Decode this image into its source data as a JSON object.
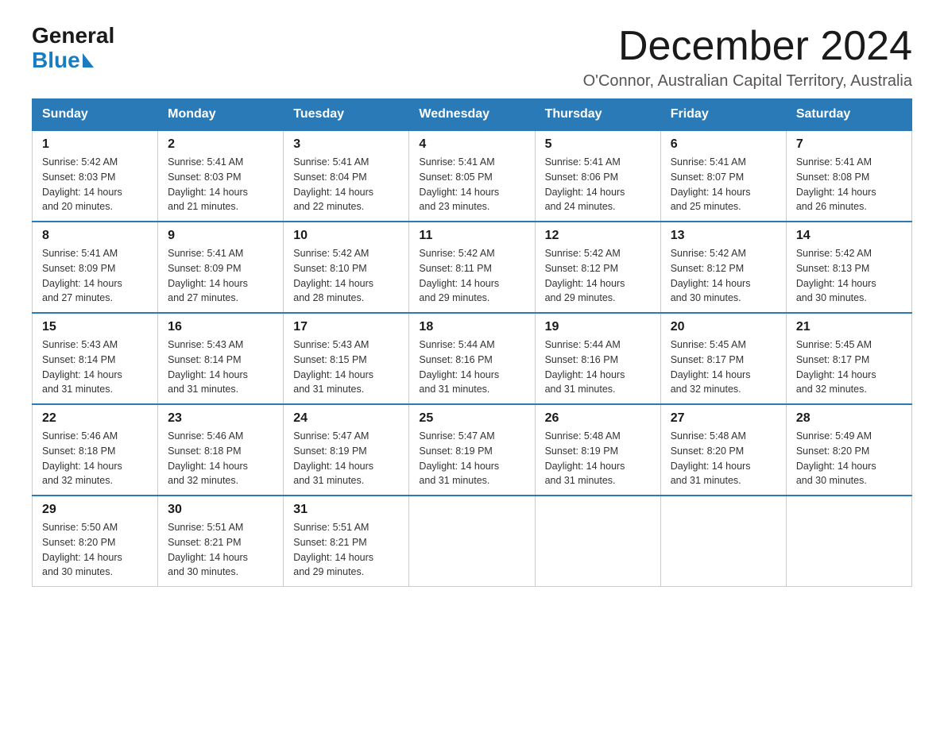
{
  "header": {
    "logo": {
      "general": "General",
      "blue": "Blue"
    },
    "title": "December 2024",
    "location": "O'Connor, Australian Capital Territory, Australia"
  },
  "calendar": {
    "days_of_week": [
      "Sunday",
      "Monday",
      "Tuesday",
      "Wednesday",
      "Thursday",
      "Friday",
      "Saturday"
    ],
    "weeks": [
      [
        {
          "day": "1",
          "sunrise": "5:42 AM",
          "sunset": "8:03 PM",
          "daylight": "14 hours and 20 minutes."
        },
        {
          "day": "2",
          "sunrise": "5:41 AM",
          "sunset": "8:03 PM",
          "daylight": "14 hours and 21 minutes."
        },
        {
          "day": "3",
          "sunrise": "5:41 AM",
          "sunset": "8:04 PM",
          "daylight": "14 hours and 22 minutes."
        },
        {
          "day": "4",
          "sunrise": "5:41 AM",
          "sunset": "8:05 PM",
          "daylight": "14 hours and 23 minutes."
        },
        {
          "day": "5",
          "sunrise": "5:41 AM",
          "sunset": "8:06 PM",
          "daylight": "14 hours and 24 minutes."
        },
        {
          "day": "6",
          "sunrise": "5:41 AM",
          "sunset": "8:07 PM",
          "daylight": "14 hours and 25 minutes."
        },
        {
          "day": "7",
          "sunrise": "5:41 AM",
          "sunset": "8:08 PM",
          "daylight": "14 hours and 26 minutes."
        }
      ],
      [
        {
          "day": "8",
          "sunrise": "5:41 AM",
          "sunset": "8:09 PM",
          "daylight": "14 hours and 27 minutes."
        },
        {
          "day": "9",
          "sunrise": "5:41 AM",
          "sunset": "8:09 PM",
          "daylight": "14 hours and 27 minutes."
        },
        {
          "day": "10",
          "sunrise": "5:42 AM",
          "sunset": "8:10 PM",
          "daylight": "14 hours and 28 minutes."
        },
        {
          "day": "11",
          "sunrise": "5:42 AM",
          "sunset": "8:11 PM",
          "daylight": "14 hours and 29 minutes."
        },
        {
          "day": "12",
          "sunrise": "5:42 AM",
          "sunset": "8:12 PM",
          "daylight": "14 hours and 29 minutes."
        },
        {
          "day": "13",
          "sunrise": "5:42 AM",
          "sunset": "8:12 PM",
          "daylight": "14 hours and 30 minutes."
        },
        {
          "day": "14",
          "sunrise": "5:42 AM",
          "sunset": "8:13 PM",
          "daylight": "14 hours and 30 minutes."
        }
      ],
      [
        {
          "day": "15",
          "sunrise": "5:43 AM",
          "sunset": "8:14 PM",
          "daylight": "14 hours and 31 minutes."
        },
        {
          "day": "16",
          "sunrise": "5:43 AM",
          "sunset": "8:14 PM",
          "daylight": "14 hours and 31 minutes."
        },
        {
          "day": "17",
          "sunrise": "5:43 AM",
          "sunset": "8:15 PM",
          "daylight": "14 hours and 31 minutes."
        },
        {
          "day": "18",
          "sunrise": "5:44 AM",
          "sunset": "8:16 PM",
          "daylight": "14 hours and 31 minutes."
        },
        {
          "day": "19",
          "sunrise": "5:44 AM",
          "sunset": "8:16 PM",
          "daylight": "14 hours and 31 minutes."
        },
        {
          "day": "20",
          "sunrise": "5:45 AM",
          "sunset": "8:17 PM",
          "daylight": "14 hours and 32 minutes."
        },
        {
          "day": "21",
          "sunrise": "5:45 AM",
          "sunset": "8:17 PM",
          "daylight": "14 hours and 32 minutes."
        }
      ],
      [
        {
          "day": "22",
          "sunrise": "5:46 AM",
          "sunset": "8:18 PM",
          "daylight": "14 hours and 32 minutes."
        },
        {
          "day": "23",
          "sunrise": "5:46 AM",
          "sunset": "8:18 PM",
          "daylight": "14 hours and 32 minutes."
        },
        {
          "day": "24",
          "sunrise": "5:47 AM",
          "sunset": "8:19 PM",
          "daylight": "14 hours and 31 minutes."
        },
        {
          "day": "25",
          "sunrise": "5:47 AM",
          "sunset": "8:19 PM",
          "daylight": "14 hours and 31 minutes."
        },
        {
          "day": "26",
          "sunrise": "5:48 AM",
          "sunset": "8:19 PM",
          "daylight": "14 hours and 31 minutes."
        },
        {
          "day": "27",
          "sunrise": "5:48 AM",
          "sunset": "8:20 PM",
          "daylight": "14 hours and 31 minutes."
        },
        {
          "day": "28",
          "sunrise": "5:49 AM",
          "sunset": "8:20 PM",
          "daylight": "14 hours and 30 minutes."
        }
      ],
      [
        {
          "day": "29",
          "sunrise": "5:50 AM",
          "sunset": "8:20 PM",
          "daylight": "14 hours and 30 minutes."
        },
        {
          "day": "30",
          "sunrise": "5:51 AM",
          "sunset": "8:21 PM",
          "daylight": "14 hours and 30 minutes."
        },
        {
          "day": "31",
          "sunrise": "5:51 AM",
          "sunset": "8:21 PM",
          "daylight": "14 hours and 29 minutes."
        },
        null,
        null,
        null,
        null
      ]
    ],
    "labels": {
      "sunrise": "Sunrise:",
      "sunset": "Sunset:",
      "daylight": "Daylight:"
    }
  }
}
